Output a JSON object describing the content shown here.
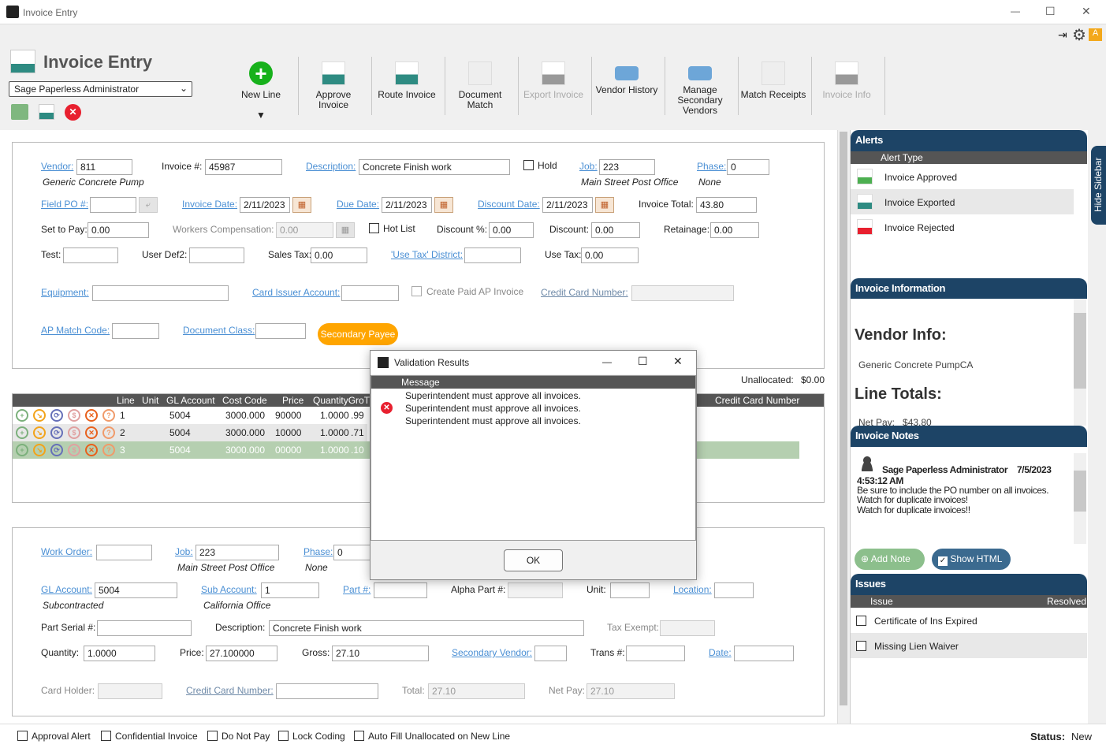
{
  "window": {
    "title": "Invoice Entry",
    "minimize": "—",
    "maximize": "☐",
    "close": "✕"
  },
  "header": {
    "title": "Invoice Entry",
    "user_select": "Sage Paperless Administrator"
  },
  "toolbar": [
    {
      "label": "New Line",
      "enabled": true
    },
    {
      "label": "Approve Invoice",
      "enabled": true
    },
    {
      "label": "Route Invoice",
      "enabled": true
    },
    {
      "label": "Document Match",
      "enabled": true
    },
    {
      "label": "Export Invoice",
      "enabled": false
    },
    {
      "label": "Vendor History",
      "enabled": true
    },
    {
      "label": "Manage Secondary Vendors",
      "enabled": true
    },
    {
      "label": "Match Receipts",
      "enabled": true
    },
    {
      "label": "Invoice Info",
      "enabled": false
    }
  ],
  "form": {
    "vendor_label": "Vendor:",
    "vendor": "811",
    "vendor_name": "Generic Concrete Pump",
    "invoice_no_label": "Invoice #:",
    "invoice_no": "45987",
    "description_label": "Description:",
    "description": "Concrete Finish work",
    "hold_label": "Hold",
    "job_label": "Job:",
    "job": "223",
    "job_name": "Main Street Post Office",
    "phase_label": "Phase:",
    "phase": "0",
    "phase_name": "None",
    "field_po_label": "Field PO #:",
    "field_po": "",
    "invoice_date_label": "Invoice Date:",
    "invoice_date": "2/11/2023",
    "due_date_label": "Due Date:",
    "due_date": "2/11/2023",
    "discount_date_label": "Discount Date:",
    "discount_date": "2/11/2023",
    "invoice_total_label": "Invoice Total:",
    "invoice_total": "43.80",
    "set_to_pay_label": "Set to Pay:",
    "set_to_pay": "0.00",
    "workers_comp_label": "Workers Compensation:",
    "workers_comp": "0.00",
    "hot_list_label": "Hot List",
    "discount_pct_label": "Discount %:",
    "discount_pct": "0.00",
    "discount_label": "Discount:",
    "discount": "0.00",
    "retainage_label": "Retainage:",
    "retainage": "0.00",
    "test_label": "Test:",
    "user_def2_label": "User Def2:",
    "sales_tax_label": "Sales Tax:",
    "sales_tax": "0.00",
    "use_tax_district_label": "'Use Tax' District:",
    "use_tax_label": "Use Tax:",
    "use_tax": "0.00",
    "equipment_label": "Equipment:",
    "card_issuer_label": "Card Issuer Account:",
    "create_paid_label": "Create Paid AP Invoice",
    "credit_card_label": "Credit Card Number:",
    "ap_match_label": "AP Match Code:",
    "document_class_label": "Document Class:",
    "secondary_payee": "Secondary Payee",
    "unallocated_label": "Unallocated:",
    "unallocated": "$0.00"
  },
  "grid": {
    "columns": [
      "Line",
      "Unit",
      "GL Account",
      "Cost Code",
      "Price",
      "QuantityGroT",
      "Credit Card Number"
    ],
    "rows": [
      {
        "line": "1",
        "unit": "",
        "gl": "5004",
        "cost_code": "3000.000",
        "price": "90000",
        "qty": "1.0000",
        "gross": ".99"
      },
      {
        "line": "2",
        "unit": "",
        "gl": "5004",
        "cost_code": "3000.000",
        "price": "10000",
        "qty": "1.0000",
        "gross": ".71"
      },
      {
        "line": "3",
        "unit": "",
        "gl": "5004",
        "cost_code": "3000.000",
        "price": "00000",
        "qty": "1.0000",
        "gross": ".10"
      }
    ]
  },
  "dialog": {
    "title": "Validation Results",
    "column": "Message",
    "messages": [
      "Superintendent must approve all invoices.",
      "Superintendent must approve all invoices.",
      "Superintendent must approve all invoices."
    ],
    "ok": "OK"
  },
  "line": {
    "work_order_label": "Work Order:",
    "job_label": "Job:",
    "job": "223",
    "job_name": "Main Street Post Office",
    "phase_label": "Phase:",
    "phase": "0",
    "phase_name": "None",
    "gl_label": "GL Account:",
    "gl": "5004",
    "gl_name": "Subcontracted",
    "sub_label": "Sub Account:",
    "sub": "1",
    "sub_name": "California Office",
    "part_label": "Part #:",
    "alpha_part_label": "Alpha Part #:",
    "unit_label": "Unit:",
    "location_label": "Location:",
    "serial_label": "Part Serial #:",
    "description_label": "Description:",
    "description": "Concrete Finish work",
    "tax_exempt_label": "Tax Exempt:",
    "quantity_label": "Quantity:",
    "quantity": "1.0000",
    "price_label": "Price:",
    "price": "27.100000",
    "gross_label": "Gross:",
    "gross": "27.10",
    "secondary_vendor_label": "Secondary Vendor:",
    "trans_label": "Trans #:",
    "date_label": "Date:",
    "card_holder_label": "Card Holder:",
    "credit_card_label": "Credit Card Number:",
    "total_label": "Total:",
    "total": "27.10",
    "net_pay_label": "Net Pay:",
    "net_pay": "27.10"
  },
  "footer": {
    "checks": [
      "Approval Alert",
      "Confidential Invoice",
      "Do Not Pay",
      "Lock Coding",
      "Auto Fill Unallocated on New Line"
    ],
    "status_label": "Status:",
    "status": "New"
  },
  "sidebar": {
    "hide": "Hide Sidebar",
    "alerts_title": "Alerts",
    "alert_type": "Alert Type",
    "alerts": [
      "Invoice Approved",
      "Invoice Exported",
      "Invoice Rejected"
    ],
    "info_title": "Invoice Information",
    "vendor_info": "Vendor Info:",
    "vendor_text": "Generic Concrete PumpCA",
    "line_totals": "Line Totals:",
    "net_pay": "Net Pay:   $43.80",
    "notes_title": "Invoice Notes",
    "note_author": "Sage Paperless Administrator",
    "note_date": "7/5/2023",
    "note_time": "4:53:12 AM",
    "note_lines": [
      "Be sure to include the PO number on all invoices.",
      "Watch for duplicate invoices!",
      "Watch for duplicate invoices!!"
    ],
    "add_note": "Add Note",
    "show_html": "Show HTML",
    "show_html_checked": true,
    "issues_title": "Issues",
    "issue_col": "Issue",
    "resolved_col": "Resolved",
    "issues": [
      "Certificate of Ins Expired",
      "Missing Lien Waiver"
    ]
  },
  "colors": {
    "link": "#4a8fd4",
    "sidebar_header": "#1d4466",
    "accent_orange": "#ffa500",
    "selected_row": "#b5cfb0"
  }
}
